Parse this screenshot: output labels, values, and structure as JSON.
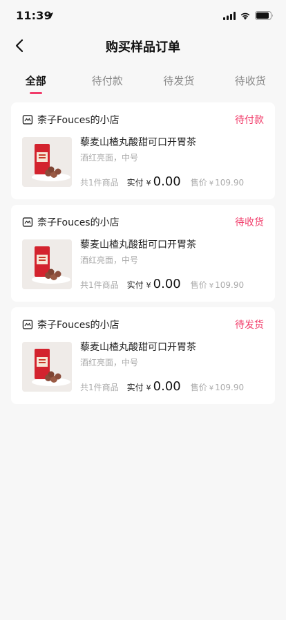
{
  "status_bar": {
    "time": "11:39",
    "location_icon": "location-arrow-icon",
    "signal_icon": "cellular-signal-icon",
    "wifi_icon": "wifi-icon",
    "battery_icon": "battery-icon"
  },
  "nav": {
    "back_icon": "chevron-left-icon",
    "title": "购买样品订单"
  },
  "tabs": [
    {
      "label": "全部",
      "active": true
    },
    {
      "label": "待付款",
      "active": false
    },
    {
      "label": "待发货",
      "active": false
    },
    {
      "label": "待收货",
      "active": false
    }
  ],
  "colors": {
    "accent": "#f13c6a",
    "background": "#f7f7f7",
    "card": "#ffffff"
  },
  "orders": [
    {
      "shop_icon": "shop-icon",
      "shop_name": "柰子Fouces的小店",
      "status": "待付款",
      "product_title": "藜麦山楂丸酸甜可口开胃茶",
      "product_spec": "酒红亮面，中号",
      "item_count": "共1件商品",
      "paid_label": "实付",
      "currency": "¥",
      "paid_amount": "0.00",
      "sale_label": "售价",
      "sale_currency": "¥",
      "sale_amount": "109.90"
    },
    {
      "shop_icon": "shop-icon",
      "shop_name": "柰子Fouces的小店",
      "status": "待收货",
      "product_title": "藜麦山楂丸酸甜可口开胃茶",
      "product_spec": "酒红亮面，中号",
      "item_count": "共1件商品",
      "paid_label": "实付",
      "currency": "¥",
      "paid_amount": "0.00",
      "sale_label": "售价",
      "sale_currency": "¥",
      "sale_amount": "109.90"
    },
    {
      "shop_icon": "shop-icon",
      "shop_name": "柰子Fouces的小店",
      "status": "待发货",
      "product_title": "藜麦山楂丸酸甜可口开胃茶",
      "product_spec": "酒红亮面，中号",
      "item_count": "共1件商品",
      "paid_label": "实付",
      "currency": "¥",
      "paid_amount": "0.00",
      "sale_label": "售价",
      "sale_currency": "¥",
      "sale_amount": "109.90"
    }
  ]
}
